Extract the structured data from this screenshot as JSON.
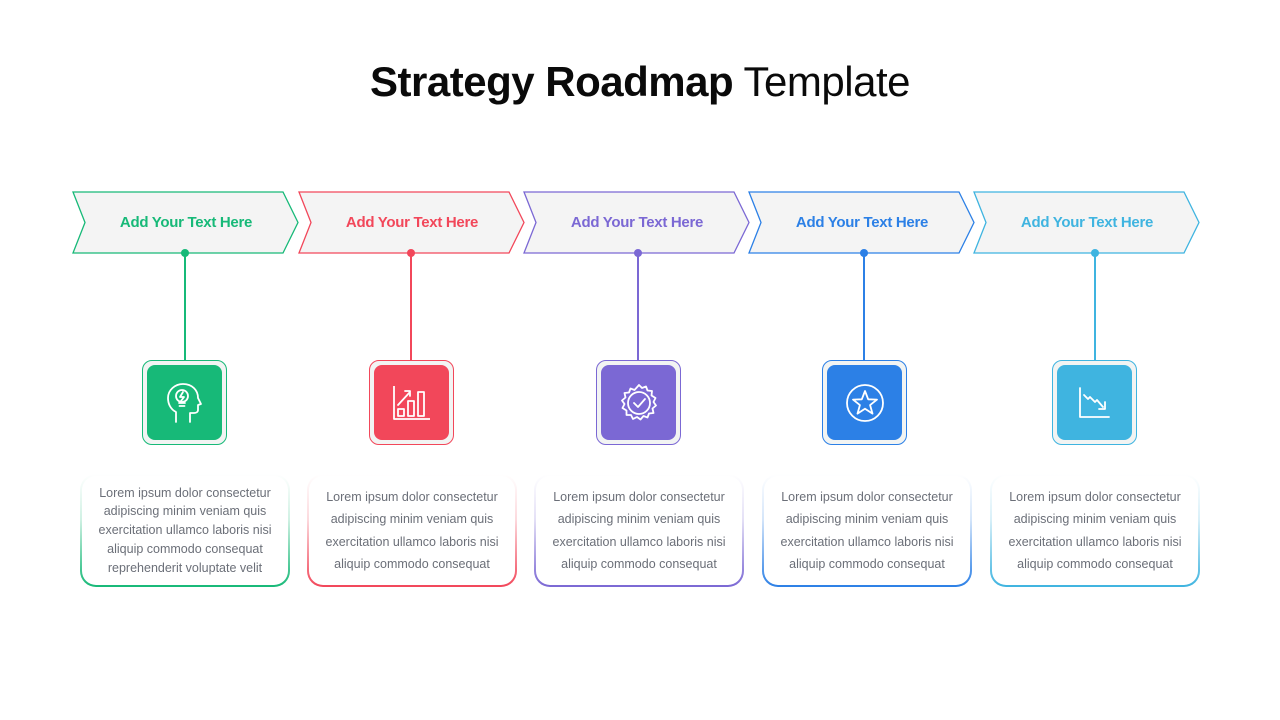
{
  "title": {
    "bold": "Strategy Roadmap",
    "light": "Template"
  },
  "steps": [
    {
      "label": "Add Your Text Here",
      "color": "#17b978",
      "icon": "head-lightbulb-icon",
      "text": "Lorem ipsum dolor consectetur adipiscing minim veniam quis exercitation ullamco laboris nisi aliquip commodo consequat reprehenderit voluptate velit"
    },
    {
      "label": "Add Your Text Here",
      "color": "#f2475a",
      "icon": "bar-chart-growth-icon",
      "text": "Lorem ipsum dolor consectetur adipiscing minim veniam quis exercitation ullamco laboris nisi aliquip commodo consequat"
    },
    {
      "label": "Add Your Text Here",
      "color": "#7b68d4",
      "icon": "badge-check-icon",
      "text": "Lorem ipsum dolor consectetur adipiscing minim veniam quis exercitation ullamco laboris nisi aliquip commodo consequat"
    },
    {
      "label": "Add Your Text Here",
      "color": "#2c80e6",
      "icon": "star-circle-icon",
      "text": "Lorem ipsum dolor consectetur adipiscing minim veniam quis exercitation ullamco laboris nisi aliquip commodo consequat"
    },
    {
      "label": "Add Your Text Here",
      "color": "#3fb4e0",
      "icon": "line-chart-decline-icon",
      "text": "Lorem ipsum dolor consectetur adipiscing minim veniam quis exercitation ullamco laboris nisi aliquip commodo consequat"
    }
  ]
}
